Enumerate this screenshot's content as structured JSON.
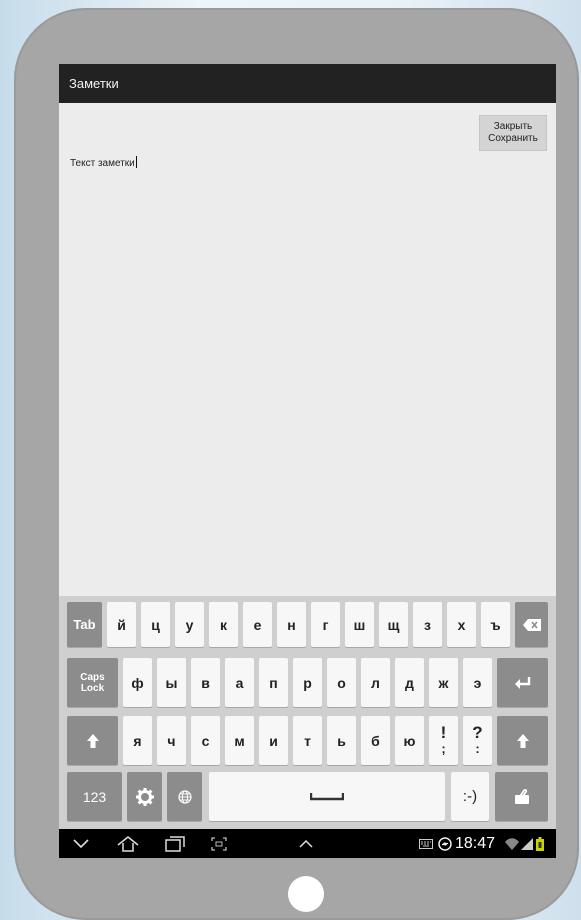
{
  "app": {
    "title": "Заметки"
  },
  "toolbar": {
    "close_label": "Закрыть",
    "save_label": "Сохранить"
  },
  "editor": {
    "text": "Текст заметки"
  },
  "keyboard": {
    "row1": [
      "й",
      "ц",
      "у",
      "к",
      "е",
      "н",
      "г",
      "ш",
      "щ",
      "з",
      "х",
      "ъ"
    ],
    "row2": [
      "ф",
      "ы",
      "в",
      "а",
      "п",
      "р",
      "о",
      "л",
      "д",
      "ж",
      "э"
    ],
    "row3": [
      "я",
      "ч",
      "с",
      "м",
      "и",
      "т",
      "ь",
      "б",
      "ю"
    ],
    "tab_label": "Tab",
    "caps_line1": "Caps",
    "caps_line2": "Lock",
    "excl": "!",
    "excl_alt": ";",
    "quest": "?",
    "quest_alt": ":",
    "numbers_label": "123",
    "emoticon_label": ":-)"
  },
  "status": {
    "time": "18:47"
  },
  "icons": {
    "backspace": "backspace-icon",
    "enter": "enter-icon",
    "shift": "shift-icon",
    "settings": "gear-icon",
    "language": "globe-icon",
    "space": "space-icon",
    "clipboard": "clipboard-icon",
    "nav_back": "chevron-down-icon",
    "nav_home": "home-icon",
    "nav_recent": "recent-apps-icon",
    "nav_screenshot": "screenshot-icon",
    "nav_up": "chevron-up-icon",
    "keyboard_status": "keyboard-icon",
    "sync": "sync-icon",
    "wifi": "wifi-icon",
    "signal": "signal-icon",
    "battery": "battery-icon"
  }
}
